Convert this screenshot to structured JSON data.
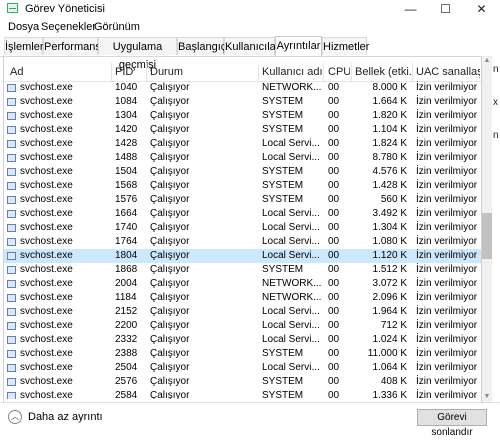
{
  "window": {
    "title": "Görev Yöneticisi",
    "minimize_glyph": "—",
    "maximize_glyph": "☐",
    "close_glyph": "✕"
  },
  "menu": [
    "Dosya",
    "Seçenekler",
    "Görünüm"
  ],
  "tabs": [
    "İşlemler",
    "Performans",
    "Uygulama geçmişi",
    "Başlangıç",
    "Kullanıcılar",
    "Ayrıntılar",
    "Hizmetler"
  ],
  "active_tab": "Ayrıntılar",
  "columns": {
    "name": "Ad",
    "pid": "PID",
    "status": "Durum",
    "user": "Kullanıcı adı",
    "cpu": "CPU",
    "memory": "Bellek (etki...",
    "uac": "UAC sanallaştır..."
  },
  "rows": [
    {
      "name": "svchost.exe",
      "pid": "1040",
      "status": "Çalışıyor",
      "user": "NETWORK...",
      "cpu": "00",
      "memory": "8.000 K",
      "uac": "İzin verilmiyor"
    },
    {
      "name": "svchost.exe",
      "pid": "1084",
      "status": "Çalışıyor",
      "user": "SYSTEM",
      "cpu": "00",
      "memory": "1.664 K",
      "uac": "İzin verilmiyor"
    },
    {
      "name": "svchost.exe",
      "pid": "1304",
      "status": "Çalışıyor",
      "user": "SYSTEM",
      "cpu": "00",
      "memory": "1.820 K",
      "uac": "İzin verilmiyor"
    },
    {
      "name": "svchost.exe",
      "pid": "1420",
      "status": "Çalışıyor",
      "user": "SYSTEM",
      "cpu": "00",
      "memory": "1.104 K",
      "uac": "İzin verilmiyor"
    },
    {
      "name": "svchost.exe",
      "pid": "1428",
      "status": "Çalışıyor",
      "user": "Local Servi...",
      "cpu": "00",
      "memory": "1.824 K",
      "uac": "İzin verilmiyor"
    },
    {
      "name": "svchost.exe",
      "pid": "1488",
      "status": "Çalışıyor",
      "user": "Local Servi...",
      "cpu": "00",
      "memory": "8.780 K",
      "uac": "İzin verilmiyor"
    },
    {
      "name": "svchost.exe",
      "pid": "1504",
      "status": "Çalışıyor",
      "user": "SYSTEM",
      "cpu": "00",
      "memory": "4.576 K",
      "uac": "İzin verilmiyor"
    },
    {
      "name": "svchost.exe",
      "pid": "1568",
      "status": "Çalışıyor",
      "user": "SYSTEM",
      "cpu": "00",
      "memory": "1.428 K",
      "uac": "İzin verilmiyor"
    },
    {
      "name": "svchost.exe",
      "pid": "1576",
      "status": "Çalışıyor",
      "user": "SYSTEM",
      "cpu": "00",
      "memory": "560 K",
      "uac": "İzin verilmiyor"
    },
    {
      "name": "svchost.exe",
      "pid": "1664",
      "status": "Çalışıyor",
      "user": "Local Servi...",
      "cpu": "00",
      "memory": "3.492 K",
      "uac": "İzin verilmiyor"
    },
    {
      "name": "svchost.exe",
      "pid": "1740",
      "status": "Çalışıyor",
      "user": "Local Servi...",
      "cpu": "00",
      "memory": "1.304 K",
      "uac": "İzin verilmiyor"
    },
    {
      "name": "svchost.exe",
      "pid": "1764",
      "status": "Çalışıyor",
      "user": "Local Servi...",
      "cpu": "00",
      "memory": "1.080 K",
      "uac": "İzin verilmiyor"
    },
    {
      "name": "svchost.exe",
      "pid": "1804",
      "status": "Çalışıyor",
      "user": "Local Servi...",
      "cpu": "00",
      "memory": "1.120 K",
      "uac": "İzin verilmiyor",
      "selected": true
    },
    {
      "name": "svchost.exe",
      "pid": "1868",
      "status": "Çalışıyor",
      "user": "SYSTEM",
      "cpu": "00",
      "memory": "1.512 K",
      "uac": "İzin verilmiyor"
    },
    {
      "name": "svchost.exe",
      "pid": "2004",
      "status": "Çalışıyor",
      "user": "NETWORK...",
      "cpu": "00",
      "memory": "3.072 K",
      "uac": "İzin verilmiyor"
    },
    {
      "name": "svchost.exe",
      "pid": "1184",
      "status": "Çalışıyor",
      "user": "NETWORK...",
      "cpu": "00",
      "memory": "2.096 K",
      "uac": "İzin verilmiyor"
    },
    {
      "name": "svchost.exe",
      "pid": "2152",
      "status": "Çalışıyor",
      "user": "Local Servi...",
      "cpu": "00",
      "memory": "1.964 K",
      "uac": "İzin verilmiyor"
    },
    {
      "name": "svchost.exe",
      "pid": "2200",
      "status": "Çalışıyor",
      "user": "Local Servi...",
      "cpu": "00",
      "memory": "712 K",
      "uac": "İzin verilmiyor"
    },
    {
      "name": "svchost.exe",
      "pid": "2332",
      "status": "Çalışıyor",
      "user": "Local Servi...",
      "cpu": "00",
      "memory": "1.024 K",
      "uac": "İzin verilmiyor"
    },
    {
      "name": "svchost.exe",
      "pid": "2388",
      "status": "Çalışıyor",
      "user": "SYSTEM",
      "cpu": "00",
      "memory": "11.000 K",
      "uac": "İzin verilmiyor"
    },
    {
      "name": "svchost.exe",
      "pid": "2504",
      "status": "Çalışıyor",
      "user": "Local Servi...",
      "cpu": "00",
      "memory": "1.064 K",
      "uac": "İzin verilmiyor"
    },
    {
      "name": "svchost.exe",
      "pid": "2576",
      "status": "Çalışıyor",
      "user": "SYSTEM",
      "cpu": "00",
      "memory": "408 K",
      "uac": "İzin verilmiyor"
    },
    {
      "name": "svchost.exe",
      "pid": "2584",
      "status": "Çalışıyor",
      "user": "SYSTEM",
      "cpu": "00",
      "memory": "1.336 K",
      "uac": "İzin verilmiyor"
    }
  ],
  "background_letters": [
    "n",
    "x",
    "n"
  ],
  "footer": {
    "collapse_label": "Daha az ayrıntı",
    "end_task_label": "Görevi sonlandır"
  },
  "colors": {
    "selection": "#cce8ff",
    "process_icon": "#5b7fbf"
  }
}
